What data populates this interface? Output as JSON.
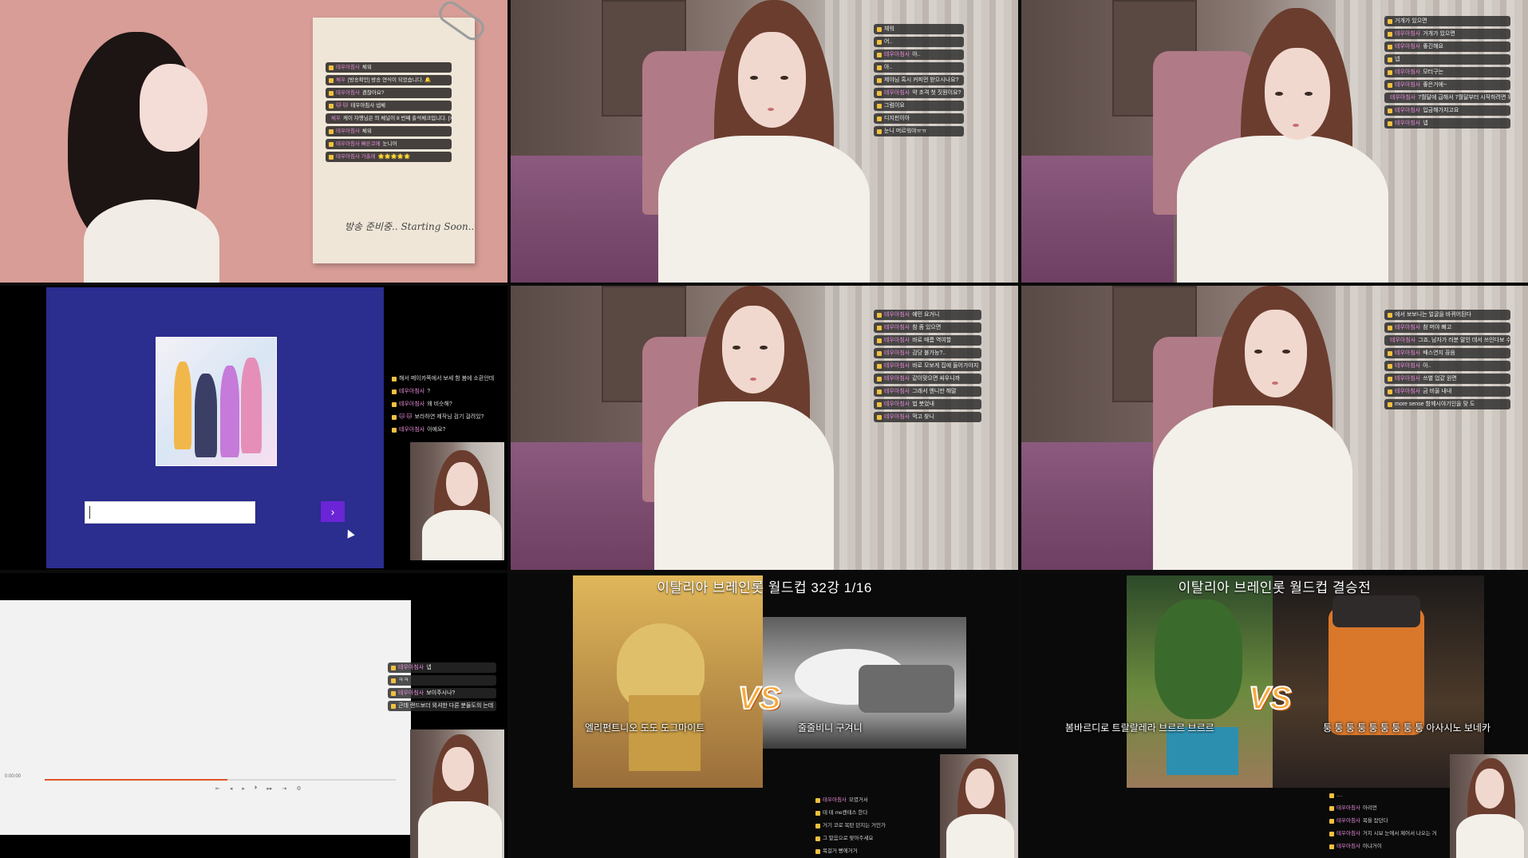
{
  "cellA": {
    "note_chat": [
      {
        "nick": "테우아침사",
        "text": "체워"
      },
      {
        "nick": "체우",
        "text": "[방송확인] 방송 연식이 되었습니다. 🔔"
      },
      {
        "nick": "테우아침사",
        "text": "괜찮아요?"
      },
      {
        "nick": "🐱 🐱",
        "text": "테우아침사 넵체"
      },
      {
        "nick": "체우",
        "text": "케이 자행님은 의 체널이 8 번째 출석체크입니다. [X연속]"
      },
      {
        "nick": "테우아침사",
        "text": "체워"
      },
      {
        "nick": "테우아침사 빠른코메",
        "text": "눈니어"
      },
      {
        "nick": "테우아침사 가출레",
        "text": "🌟🌟🌟🌟🌟"
      }
    ],
    "caption": "방송 준비중.. Starting Soon.."
  },
  "cellB": {
    "chat": [
      {
        "nick": "",
        "text": "체워"
      },
      {
        "nick": "",
        "text": "어.."
      },
      {
        "nick": "테우아침사",
        "text": "아.."
      },
      {
        "nick": "",
        "text": "아.."
      },
      {
        "nick": "",
        "text": "제야님 혹시 커피먼 받으시나요?"
      },
      {
        "nick": "테우아침사",
        "text": "약 초격 첫 짓뭔이요?"
      },
      {
        "nick": "",
        "text": "그럼이요"
      },
      {
        "nick": "",
        "text": "디지핀이아"
      },
      {
        "nick": "",
        "text": "눈니 머르워야ㅠㅠ"
      }
    ]
  },
  "cellC": {
    "chat": [
      {
        "nick": "",
        "text": "거개가 있으면"
      },
      {
        "nick": "테우아침사",
        "text": "거개가 있으면"
      },
      {
        "nick": "테우아침사",
        "text": "좋긴해요"
      },
      {
        "nick": "",
        "text": "넵"
      },
      {
        "nick": "테우아침사",
        "text": "모터구는"
      },
      {
        "nick": "테우아침사",
        "text": "좋은거에~"
      },
      {
        "nick": "테우아침사",
        "text": "7월달에 급해서 7월달부터 시작하려면 위중해요"
      },
      {
        "nick": "테우아침사",
        "text": "입금해가지고요"
      },
      {
        "nick": "테우아침사",
        "text": "넵"
      }
    ]
  },
  "cellD": {
    "search_placeholder": "",
    "go_button": "›",
    "side_chat": [
      {
        "nick": "",
        "text": "해서 메이카쪽에서 보세 함 봄에 소환안데"
      },
      {
        "nick": "테우아침사",
        "text": "?"
      },
      {
        "nick": "테우아침사",
        "text": "왜 비슷해?"
      },
      {
        "nick": "🐱 🐱",
        "text": "보라하연 제작님 검기 걸려있?"
      },
      {
        "nick": "테우아침사",
        "text": "아예요?"
      }
    ]
  },
  "cellE": {
    "chat": [
      {
        "nick": "테우아침사",
        "text": "예민 요거니"
      },
      {
        "nick": "테우아침사",
        "text": "참 좀 있으면"
      },
      {
        "nick": "테우아침사",
        "text": "바로 때름 역여할"
      },
      {
        "nick": "테우아침사",
        "text": "감당 불가능?.."
      },
      {
        "nick": "테우아침사",
        "text": "바로 모보게 집에 들어가야지"
      },
      {
        "nick": "테우아침사",
        "text": "같이맞으면 싸우니까"
      },
      {
        "nick": "테우아침사",
        "text": "그래서 엔니만 해말"
      },
      {
        "nick": "테우아침사",
        "text": "법 봇었내"
      },
      {
        "nick": "테우아침사",
        "text": "먹고 찾니"
      }
    ]
  },
  "cellF": {
    "chat": [
      {
        "nick": "",
        "text": "에서 보보니는 얼굴을 바뀌어된다"
      },
      {
        "nick": "테우아침사",
        "text": "참 머야 빠고"
      },
      {
        "nick": "테우아침사",
        "text": "그죠, 남자가 러분 말인 데서 쓰인다보 수는 없다보니"
      },
      {
        "nick": "테우아침사",
        "text": "배스연지 끊음"
      },
      {
        "nick": "테우아침사",
        "text": "아.."
      },
      {
        "nick": "테우아침사",
        "text": "쓰별 업같 원면"
      },
      {
        "nick": "테우아침사",
        "text": "금 비울 내내"
      },
      {
        "nick": "",
        "text": "more sense 함께시야기인을 맞 도"
      }
    ]
  },
  "cellG": {
    "chat": [
      {
        "nick": "테우아침사",
        "text": "넵"
      },
      {
        "nick": "",
        "text": "ㅋㅋ"
      },
      {
        "nick": "테우아침사",
        "text": "보이주시나?"
      },
      {
        "nick": "",
        "text": "근데 랜드보더 외셔한 다른 분들도의 는데"
      }
    ],
    "time": "0:00:00",
    "controls": [
      "⇤",
      "◂",
      "▸",
      "⏵",
      "▸▸",
      "⇥",
      "⚙"
    ]
  },
  "cellH": {
    "title": "이탈리아 브레인롯 월드컵   32강   1/16",
    "left_name": "엘리펀트니오 도도 도그마이트",
    "right_name": "줄줄비니 구겨니",
    "vs": "VS",
    "chat": [
      {
        "nick": "테우아침사",
        "text": "모였거서"
      },
      {
        "nick": "",
        "text": "테 테 me켄테스 한다"
      },
      {
        "nick": "",
        "text": "거기 코로 목탄 던지는 거인가"
      },
      {
        "nick": "",
        "text": "그 말음으로 맞아주세요"
      },
      {
        "nick": "",
        "text": "목걸거 빵에거거"
      }
    ]
  },
  "cellI": {
    "title": "이탈리아 브레인롯 월드컵    결승전",
    "left_name": "봄바르디로 트랄랄레라 브르르 브르르",
    "right_name": "퉁 퉁 퉁 퉁 퉁 퉁 퉁 퉁 퉁 아사시노 보네카",
    "vs": "VS",
    "chat": [
      {
        "nick": "",
        "text": "...."
      },
      {
        "nick": "테우아침사",
        "text": "아리먼"
      },
      {
        "nick": "테우아침사",
        "text": "목을 잡던다"
      },
      {
        "nick": "테우아침사",
        "text": "거지 시보 눈에서 제어서 나오는 거"
      },
      {
        "nick": "테우아침사",
        "text": "아냐거이"
      }
    ]
  },
  "colors": {
    "accent_purple": "#6b24d6",
    "panel_blue": "#2b2d8f",
    "chat_nick": "#e38ad4",
    "vs_orange": "#f6a93a",
    "progress": "#e0542b"
  }
}
